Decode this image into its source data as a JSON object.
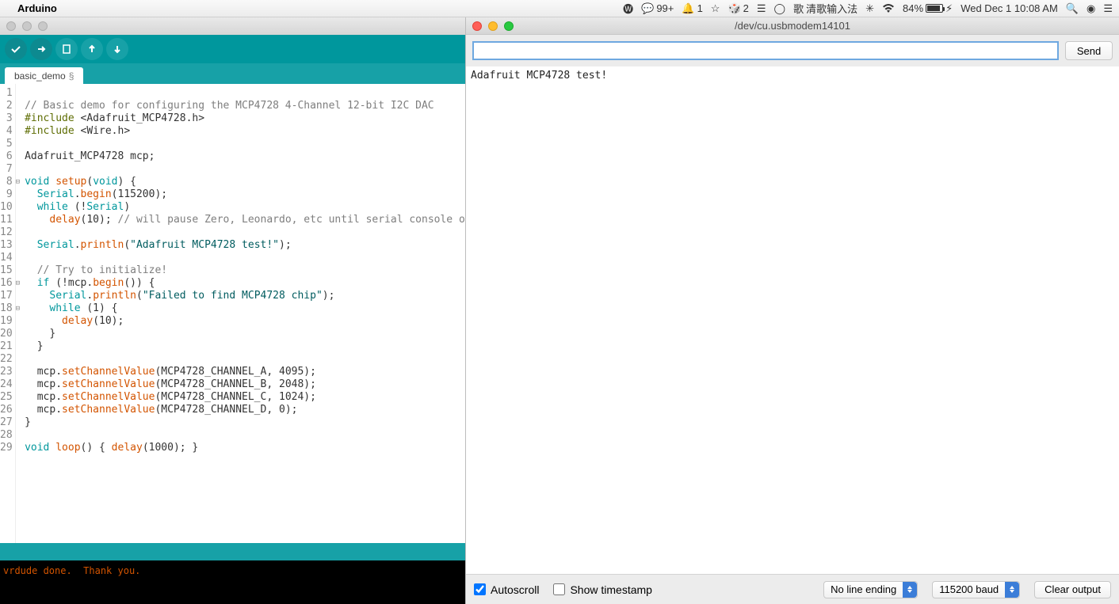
{
  "menubar": {
    "app_name": "Arduino",
    "wechat_badge": "99+",
    "bell_badge": "1",
    "dice_badge": "2",
    "ime_label": "清歌输入法",
    "battery_pct": "84%",
    "datetime": "Wed Dec 1  10:08 AM"
  },
  "ide": {
    "tab_name": "basic_demo",
    "tab_marker": "§",
    "code_lines": [
      {
        "n": 1,
        "type": "blank"
      },
      {
        "n": 2,
        "type": "comment",
        "text": "// Basic demo for configuring the MCP4728 4-Channel 12-bit I2C DAC"
      },
      {
        "n": 3,
        "type": "include",
        "lib": "Adafruit_MCP4728.h"
      },
      {
        "n": 4,
        "type": "include",
        "lib": "Wire.h"
      },
      {
        "n": 5,
        "type": "blank"
      },
      {
        "n": 6,
        "type": "decl",
        "text1": "Adafruit_MCP4728 mcp;"
      },
      {
        "n": 7,
        "type": "blank"
      },
      {
        "n": 8,
        "fold": "⊟",
        "type": "funcdef",
        "kw": "void",
        "name": "setup",
        "arg": "void",
        "tail": ") {"
      },
      {
        "n": 9,
        "type": "serial",
        "indent": "  ",
        "obj": "Serial",
        "dot": ".",
        "fn": "begin",
        "args": "(115200);"
      },
      {
        "n": 10,
        "type": "while_serial",
        "indent": "  ",
        "kw": "while",
        "tail": " (!",
        "obj": "Serial",
        "end": ")"
      },
      {
        "n": 11,
        "type": "delay",
        "indent": "    ",
        "fn": "delay",
        "args": "(10);",
        "comment": " // will pause Zero, Leonardo, etc until serial console opens"
      },
      {
        "n": 12,
        "type": "blank"
      },
      {
        "n": 13,
        "type": "serial",
        "indent": "  ",
        "obj": "Serial",
        "dot": ".",
        "fn": "println",
        "args_pre": "(",
        "str": "\"Adafruit MCP4728 test!\"",
        "args_post": ");"
      },
      {
        "n": 14,
        "type": "blank"
      },
      {
        "n": 15,
        "type": "comment",
        "indent": "  ",
        "text": "// Try to initialize!"
      },
      {
        "n": 16,
        "fold": "⊟",
        "type": "if_begin",
        "indent": "  ",
        "kw": "if",
        "tail": " (!mcp.",
        "fn": "begin",
        "end": "()) {"
      },
      {
        "n": 17,
        "type": "serial",
        "indent": "    ",
        "obj": "Serial",
        "dot": ".",
        "fn": "println",
        "args_pre": "(",
        "str": "\"Failed to find MCP4728 chip\"",
        "args_post": ");"
      },
      {
        "n": 18,
        "fold": "⊟",
        "type": "while1",
        "indent": "    ",
        "kw": "while",
        "tail": " (1) {"
      },
      {
        "n": 19,
        "type": "delay",
        "indent": "      ",
        "fn": "delay",
        "args": "(10);"
      },
      {
        "n": 20,
        "type": "plain",
        "indent": "    ",
        "text": "}"
      },
      {
        "n": 21,
        "type": "plain",
        "indent": "  ",
        "text": "}"
      },
      {
        "n": 22,
        "type": "blank"
      },
      {
        "n": 23,
        "type": "mcp",
        "indent": "  ",
        "pre": "mcp.",
        "fn": "setChannelValue",
        "args": "(MCP4728_CHANNEL_A, 4095);"
      },
      {
        "n": 24,
        "type": "mcp",
        "indent": "  ",
        "pre": "mcp.",
        "fn": "setChannelValue",
        "args": "(MCP4728_CHANNEL_B, 2048);"
      },
      {
        "n": 25,
        "type": "mcp",
        "indent": "  ",
        "pre": "mcp.",
        "fn": "setChannelValue",
        "args": "(MCP4728_CHANNEL_C, 1024);"
      },
      {
        "n": 26,
        "type": "mcp",
        "indent": "  ",
        "pre": "mcp.",
        "fn": "setChannelValue",
        "args": "(MCP4728_CHANNEL_D, 0);"
      },
      {
        "n": 27,
        "type": "plain",
        "text": "}"
      },
      {
        "n": 28,
        "type": "blank"
      },
      {
        "n": 29,
        "type": "loop",
        "kw": "void",
        "name": "loop",
        "mid": "() { ",
        "fn": "delay",
        "args": "(1000); }"
      }
    ],
    "console_text": "vrdude done.  Thank you."
  },
  "serial": {
    "title": "/dev/cu.usbmodem14101",
    "send_label": "Send",
    "output_text": "Adafruit MCP4728 test!",
    "autoscroll_label": "Autoscroll",
    "show_ts_label": "Show timestamp",
    "line_ending": "No line ending",
    "baud": "115200 baud",
    "clear_label": "Clear output"
  }
}
